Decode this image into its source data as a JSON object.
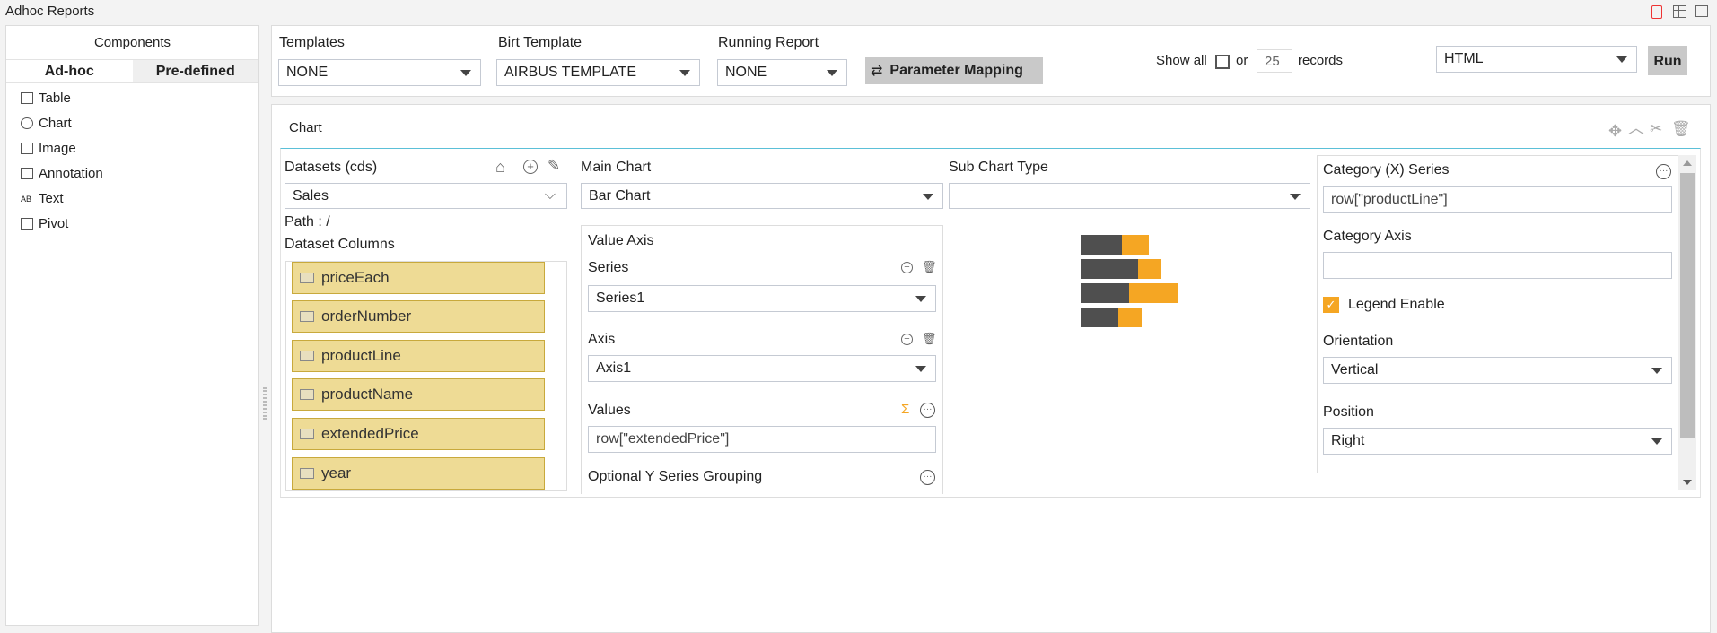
{
  "app": {
    "title": "Adhoc Reports",
    "top_icons": [
      "save-icon",
      "table-icon",
      "comment-icon"
    ]
  },
  "sidebar": {
    "header": "Components",
    "tabs": [
      {
        "label": "Ad-hoc",
        "active": true
      },
      {
        "label": "Pre-defined",
        "active": false
      }
    ],
    "items": [
      {
        "label": "Table",
        "icon": "table-icon"
      },
      {
        "label": "Chart",
        "icon": "chart-icon"
      },
      {
        "label": "Image",
        "icon": "image-icon"
      },
      {
        "label": "Annotation",
        "icon": "annotation-icon"
      },
      {
        "label": "Text",
        "icon": "text-icon"
      },
      {
        "label": "Pivot",
        "icon": "pivot-icon"
      }
    ]
  },
  "toolbar": {
    "templates_label": "Templates",
    "templates_value": "NONE",
    "birt_label": "Birt Template",
    "birt_value": "AIRBUS TEMPLATE",
    "running_label": "Running Report",
    "running_value": "NONE",
    "param_mapping": "Parameter Mapping",
    "show_all": "Show all",
    "or": "or",
    "records_value": "25",
    "records": "records",
    "format_value": "HTML",
    "run": "Run"
  },
  "chart_panel": {
    "title": "Chart",
    "icons": [
      "move-icon",
      "collapse-icon",
      "tools-icon",
      "trash-icon"
    ],
    "datasets": {
      "label": "Datasets (cds)",
      "value": "Sales",
      "path": "Path : /",
      "columns_label": "Dataset Columns",
      "columns": [
        "priceEach",
        "orderNumber",
        "productLine",
        "productName",
        "extendedPrice",
        "year"
      ]
    },
    "main_chart": {
      "label": "Main Chart",
      "value": "Bar Chart",
      "value_axis": "Value Axis",
      "series_label": "Series",
      "series_value": "Series1",
      "axis_label": "Axis",
      "axis_value": "Axis1",
      "values_label": "Values",
      "values_value": "row[\"extendedPrice\"]",
      "optional_label": "Optional Y Series Grouping"
    },
    "sub_chart": {
      "label": "Sub Chart Type",
      "value": ""
    },
    "category": {
      "series_label": "Category (X) Series",
      "series_value": "row[\"productLine\"]",
      "axis_label": "Category Axis",
      "axis_value": "",
      "legend_label": "Legend Enable",
      "legend_checked": true,
      "orientation_label": "Orientation",
      "orientation_value": "Vertical",
      "position_label": "Position",
      "position_value": "Right"
    }
  },
  "colors": {
    "accent": "#f5a623",
    "dark": "#4f4f4f",
    "column_bg": "#eedb95",
    "divider": "#5bc0d8"
  }
}
